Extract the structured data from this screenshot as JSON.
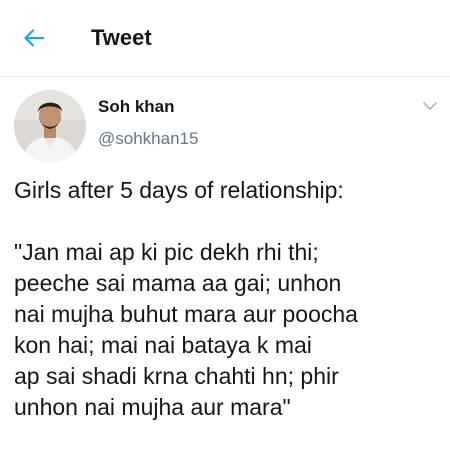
{
  "header": {
    "title": "Tweet",
    "back_icon": "arrow-left-icon",
    "accent_color": "#1da1f2"
  },
  "author": {
    "display_name": "Soh khan",
    "handle": "@sohkhan15",
    "avatar_icon": "profile-photo",
    "more_icon": "chevron-down-icon"
  },
  "tweet": {
    "intro": "Girls after 5 days of relationship:",
    "quote_lines": [
      "\"Jan mai ap ki pic dekh rhi thi;",
      "peeche sai mama aa gai; unhon",
      "nai mujha buhut mara aur poocha",
      "kon hai; mai nai bataya k mai",
      "ap sai shadi krna chahti hn; phir",
      "unhon nai mujha aur mara\""
    ]
  }
}
